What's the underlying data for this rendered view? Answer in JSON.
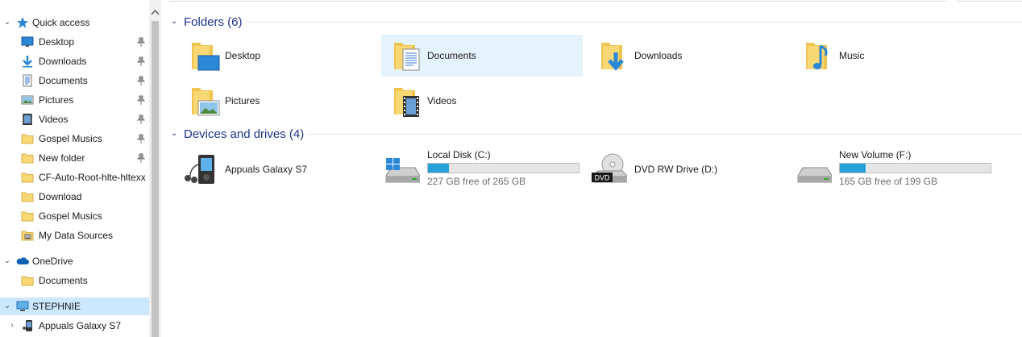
{
  "sidebar": {
    "quick_access": {
      "label": "Quick access"
    },
    "items": [
      {
        "label": "Desktop",
        "icon": "desktop-icon",
        "pinned": true
      },
      {
        "label": "Downloads",
        "icon": "downloads-icon",
        "pinned": true
      },
      {
        "label": "Documents",
        "icon": "documents-icon",
        "pinned": true
      },
      {
        "label": "Pictures",
        "icon": "pictures-icon",
        "pinned": true
      },
      {
        "label": "Videos",
        "icon": "videos-icon",
        "pinned": true
      },
      {
        "label": "Gospel Musics",
        "icon": "folder-icon",
        "pinned": true
      },
      {
        "label": "New folder",
        "icon": "folder-icon",
        "pinned": true
      },
      {
        "label": "CF-Auto-Root-hlte-hltexx",
        "icon": "folder-icon",
        "pinned": false
      },
      {
        "label": "Download",
        "icon": "folder-icon",
        "pinned": false
      },
      {
        "label": "Gospel Musics",
        "icon": "folder-icon",
        "pinned": false
      },
      {
        "label": "My Data Sources",
        "icon": "data-sources-icon",
        "pinned": false
      }
    ],
    "onedrive": {
      "label": "OneDrive",
      "items": [
        {
          "label": "Documents"
        }
      ]
    },
    "this_pc": {
      "label": "STEPHNIE",
      "items": [
        {
          "label": "Appuals Galaxy S7"
        }
      ]
    }
  },
  "folders": {
    "title": "Folders (6)",
    "items": [
      {
        "label": "Desktop",
        "icon": "desktop-folder-icon"
      },
      {
        "label": "Documents",
        "icon": "documents-folder-icon"
      },
      {
        "label": "Downloads",
        "icon": "downloads-folder-icon"
      },
      {
        "label": "Music",
        "icon": "music-folder-icon"
      },
      {
        "label": "Pictures",
        "icon": "pictures-folder-icon"
      },
      {
        "label": "Videos",
        "icon": "videos-folder-icon"
      }
    ]
  },
  "devices": {
    "title": "Devices and drives (4)",
    "items": [
      {
        "label": "Appuals Galaxy S7",
        "icon": "media-player-icon"
      },
      {
        "label": "Local Disk (C:)",
        "free": "227 GB free of 265 GB",
        "used_fraction": 0.14,
        "icon": "windows-drive-icon"
      },
      {
        "label": "DVD RW Drive (D:)",
        "icon": "dvd-drive-icon",
        "badge": "DVD"
      },
      {
        "label": "New Volume (F:)",
        "free": "165 GB free of 199 GB",
        "used_fraction": 0.17,
        "icon": "hard-drive-icon"
      }
    ]
  },
  "colors": {
    "accent": "#1e3287",
    "selection": "#cce8ff",
    "hover": "#e5f3ff",
    "bar": "#26a0da",
    "folder": "#f8d775"
  }
}
